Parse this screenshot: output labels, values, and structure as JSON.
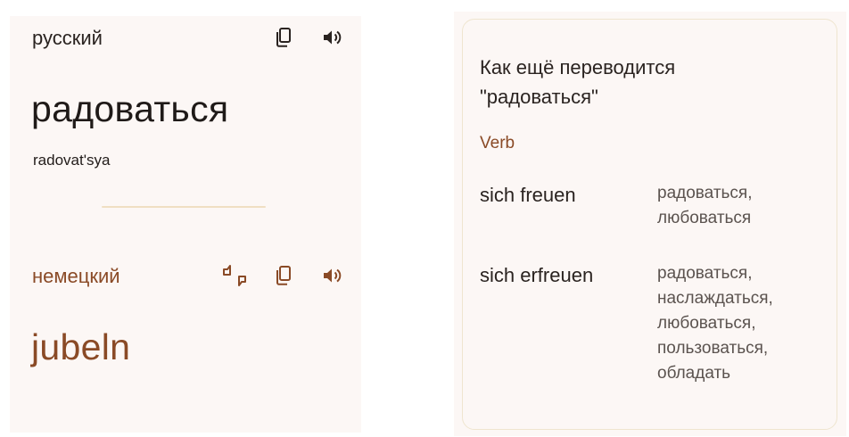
{
  "source": {
    "language": "русский",
    "word": "радоваться",
    "transliteration": "radovat'sya",
    "icons": [
      "copy-icon",
      "speaker-icon"
    ]
  },
  "target": {
    "language": "немецкий",
    "word": "jubeln",
    "icons": [
      "feedback-icon",
      "copy-icon",
      "speaker-icon"
    ]
  },
  "alternatives": {
    "title": "Как ещё переводится \"радоваться\"",
    "part_of_speech": "Verb",
    "entries": [
      {
        "word": "sich freuen",
        "translations": "радоваться, любоваться"
      },
      {
        "word": "sich erfreuen",
        "translations": "радоваться, наслаждаться, любоваться, пользоваться, обладать"
      }
    ]
  },
  "colors": {
    "accent": "#8a4a26",
    "panel_bg": "#fcf7f5",
    "divider": "#f0dfc3",
    "card_border": "#efe5cf"
  }
}
